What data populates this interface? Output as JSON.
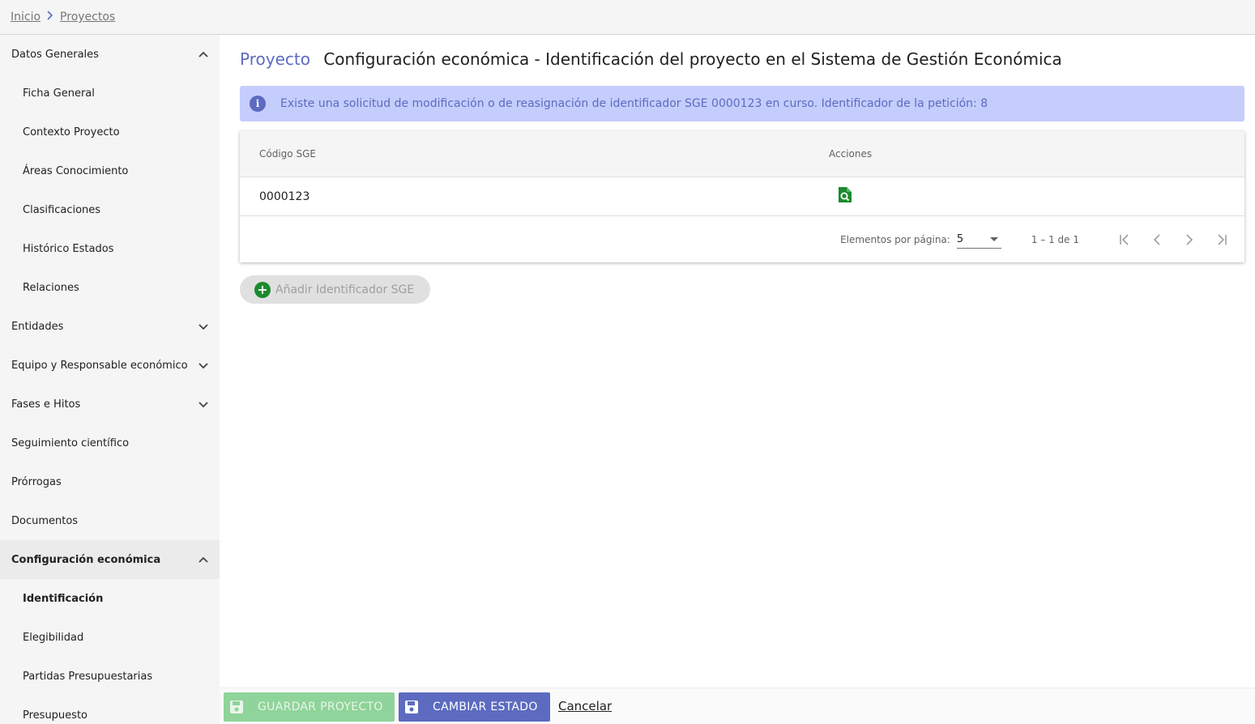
{
  "breadcrumb": {
    "home": "Inicio",
    "current": "Proyectos"
  },
  "sidebar": {
    "items": [
      {
        "label": "Datos Generales",
        "level": 0,
        "chevron": "up"
      },
      {
        "label": "Ficha General",
        "level": 1
      },
      {
        "label": "Contexto Proyecto",
        "level": 1
      },
      {
        "label": "Áreas Conocimiento",
        "level": 1
      },
      {
        "label": "Clasificaciones",
        "level": 1
      },
      {
        "label": "Histórico Estados",
        "level": 1
      },
      {
        "label": "Relaciones",
        "level": 1
      },
      {
        "label": "Entidades",
        "level": 0,
        "chevron": "down"
      },
      {
        "label": "Equipo y Responsable económico",
        "level": 0,
        "chevron": "down"
      },
      {
        "label": "Fases e Hitos",
        "level": 0,
        "chevron": "down"
      },
      {
        "label": "Seguimiento científico",
        "level": 0
      },
      {
        "label": "Prórrogas",
        "level": 0
      },
      {
        "label": "Documentos",
        "level": 0
      },
      {
        "label": "Configuración económica",
        "level": 0,
        "chevron": "up",
        "active_group": true
      },
      {
        "label": "Identificación",
        "level": 1,
        "active": true
      },
      {
        "label": "Elegibilidad",
        "level": 1
      },
      {
        "label": "Partidas Presupuestarias",
        "level": 1
      },
      {
        "label": "Presupuesto",
        "level": 1
      }
    ]
  },
  "header": {
    "section": "Proyecto",
    "title": "Configuración económica - Identificación del proyecto en el Sistema de Gestión Económica"
  },
  "alert": {
    "icon": "info-icon",
    "text": "Existe una solicitud de modificación o de reasignación de identificador SGE 0000123 en curso. Identificador de la petición: 8"
  },
  "table": {
    "columns": [
      "Código SGE",
      "Acciones"
    ],
    "rows": [
      {
        "codigo": "0000123",
        "action_icon": "view-document-icon"
      }
    ],
    "paginator": {
      "label": "Elementos por página:",
      "page_size": "5",
      "range": "1 – 1 de 1"
    }
  },
  "add_button": {
    "label": "Añadir Identificador SGE"
  },
  "footer": {
    "save_label": "GUARDAR PROYECTO",
    "change_state_label": "CAMBIAR ESTADO",
    "cancel_label": "Cancelar"
  },
  "colors": {
    "accent": "#5c6bc0",
    "alert_bg": "#c5cdfc",
    "success": "#1b8a2e",
    "save_disabled": "#8fd49a"
  }
}
